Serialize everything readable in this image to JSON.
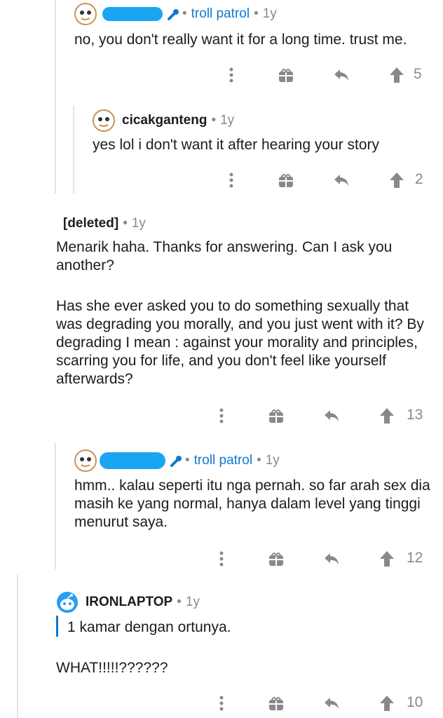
{
  "colors": {
    "accent": "#0f79d0",
    "redaction": "#1aa5f2",
    "icon_gray": "#878a8c",
    "thread_line": "#e4e4e4"
  },
  "comments": [
    {
      "author": "",
      "author_redacted": true,
      "flair": "troll patrol",
      "age": "1y",
      "body": [
        "no, you don't really want it for a long time. trust me."
      ],
      "votes": "5"
    },
    {
      "author": "cicakganteng",
      "author_redacted": false,
      "flair": "",
      "age": "1y",
      "body": [
        "yes lol i don't want it after hearing your story"
      ],
      "votes": "2"
    },
    {
      "author": "[deleted]",
      "author_redacted": false,
      "flair": "",
      "age": "1y",
      "body": [
        "Menarik haha. Thanks for answering. Can I ask you another?",
        "Has she ever asked you to do something sexually that was degrading you morally, and you just went with it? By degrading I mean : against your morality and principles, scarring you for life, and you don't feel like yourself afterwards?"
      ],
      "votes": "13"
    },
    {
      "author": "",
      "author_redacted": true,
      "flair": "troll patrol",
      "age": "1y",
      "body": [
        "hmm.. kalau seperti itu nga pernah. so far arah sex dia masih ke yang normal, hanya dalam level yang tinggi menurut saya."
      ],
      "votes": "12"
    },
    {
      "author": "IRONLAPTOP",
      "author_redacted": false,
      "flair": "",
      "age": "1y",
      "quote": "1 kamar dengan ortunya.",
      "body": [
        "WHAT!!!!!??????"
      ],
      "votes": "10"
    }
  ],
  "icons": {
    "more": "more-vertical-icon",
    "award": "gift-icon",
    "reply": "reply-arrow-icon",
    "upvote": "upvote-arrow-icon",
    "mod": "wrench-icon"
  }
}
